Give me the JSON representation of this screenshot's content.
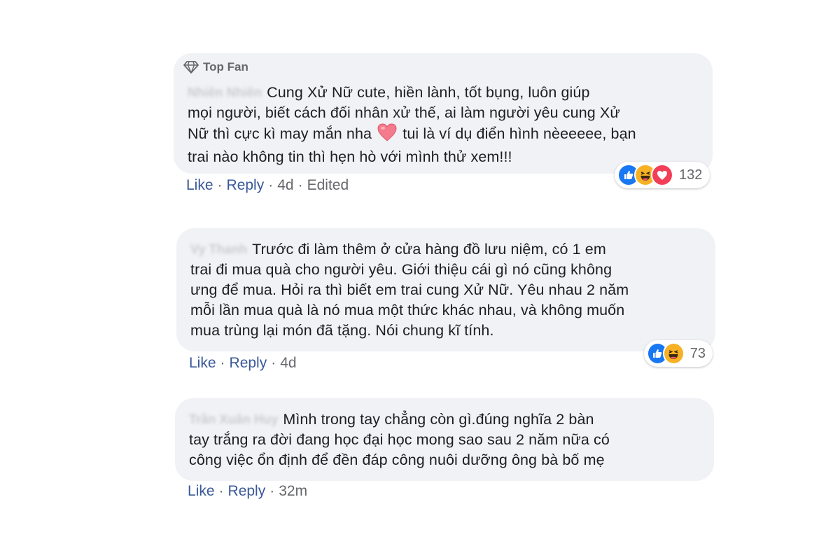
{
  "comments": [
    {
      "badge": "Top Fan",
      "author": "Nhiên Nhiên",
      "body_lines": [
        "Cung Xử Nữ cute, hiền lành, tốt bụng, luôn giúp",
        "mọi người, biết cách đối nhân xử thế, ai làm người yêu cung Xử",
        "Nữ thì cực kì may mắn nha",
        "tui là ví dụ điển hình nèeeeee, bạn",
        "trai nào không tin thì hẹn hò với mình thử xem!!!"
      ],
      "actions": {
        "like": "Like",
        "reply": "Reply",
        "time": "4d",
        "edited": "Edited"
      },
      "reactions": {
        "icons": [
          "like-icon",
          "haha-icon",
          "love-icon"
        ],
        "count": "132"
      }
    },
    {
      "author": "Vy Thanh",
      "body_lines": [
        "Trước đi làm thêm ở cửa hàng đồ lưu niệm, có 1 em",
        "trai đi mua quà cho người yêu. Giới thiệu cái gì nó cũng không",
        "ưng để mua. Hỏi ra thì biết em trai cung Xử Nữ. Yêu nhau 2 năm",
        "mỗi lần mua quà là nó mua một thức khác nhau, và không muốn",
        "mua trùng lại món đã tặng. Nói chung kĩ tính."
      ],
      "actions": {
        "like": "Like",
        "reply": "Reply",
        "time": "4d"
      },
      "reactions": {
        "icons": [
          "like-icon",
          "haha-icon"
        ],
        "count": "73"
      }
    },
    {
      "author": "Trần Xuân Huy",
      "body_lines": [
        "Mình trong tay chẳng còn gì.đúng nghĩa 2 bàn",
        "tay trắng ra đời đang học đại học mong sao sau 2 năm nữa có",
        "công việc ổn định để đền đáp công nuôi dưỡng ông bà bố mẹ"
      ],
      "actions": {
        "like": "Like",
        "reply": "Reply",
        "time": "32m"
      }
    }
  ],
  "colors": {
    "bubble": "#f0f2f5",
    "text": "#1c1e21",
    "link": "#385898",
    "meta": "#65676b",
    "like": "#1877f2",
    "haha": "#f7b125",
    "love": "#f33e58"
  }
}
